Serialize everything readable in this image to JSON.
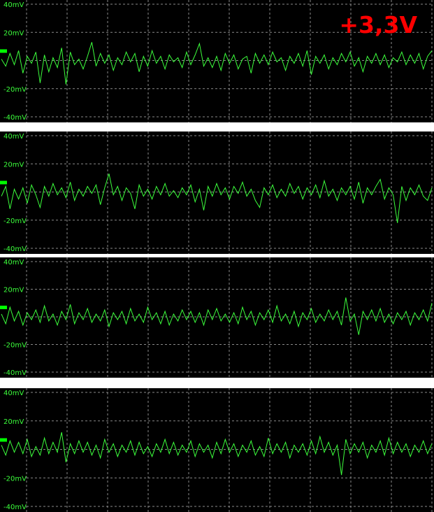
{
  "badge": {
    "label": "+3,3V",
    "color": "#ff0000"
  },
  "colors": {
    "background": "#000000",
    "grid": "#8a8a8a",
    "trace": "#3cff3c",
    "tick_text": "#3cff3c",
    "marker": "#00ff00"
  },
  "chart_data": [
    {
      "type": "line",
      "ytick_labels": [
        "40mV",
        "20mV",
        "",
        "-20mV",
        "-40mV"
      ],
      "ylim": [
        -40,
        40
      ],
      "grid": true,
      "x": [
        0,
        0.01,
        0.02,
        0.03,
        0.04,
        0.05,
        0.06,
        0.07,
        0.08,
        0.09,
        0.1,
        0.11,
        0.12,
        0.13,
        0.14,
        0.15,
        0.16,
        0.17,
        0.18,
        0.19,
        0.2,
        0.21,
        0.22,
        0.23,
        0.24,
        0.25,
        0.26,
        0.27,
        0.28,
        0.29,
        0.3,
        0.31,
        0.32,
        0.33,
        0.34,
        0.35,
        0.36,
        0.37,
        0.38,
        0.39,
        0.4,
        0.41,
        0.42,
        0.43,
        0.44,
        0.45,
        0.46,
        0.47,
        0.48,
        0.49,
        0.5,
        0.51,
        0.52,
        0.53,
        0.54,
        0.55,
        0.56,
        0.57,
        0.58,
        0.59,
        0.6,
        0.61,
        0.62,
        0.63,
        0.64,
        0.65,
        0.66,
        0.67,
        0.68,
        0.69,
        0.7,
        0.71,
        0.72,
        0.73,
        0.74,
        0.75,
        0.76,
        0.77,
        0.78,
        0.79,
        0.8,
        0.81,
        0.82,
        0.83,
        0.84,
        0.85,
        0.86,
        0.87,
        0.88,
        0.89,
        0.9,
        0.91,
        0.92,
        0.93,
        0.94,
        0.95,
        0.96,
        0.97,
        0.98,
        0.99,
        1
      ],
      "values": [
        1,
        -4,
        5,
        -3,
        7,
        -9,
        3,
        -2,
        6,
        -16,
        4,
        -8,
        2,
        -5,
        9,
        -17,
        6,
        -3,
        1,
        -6,
        3,
        13,
        -4,
        5,
        -2,
        4,
        -7,
        2,
        -3,
        6,
        -1,
        5,
        -8,
        3,
        -4,
        7,
        -2,
        3,
        -6,
        4,
        -1,
        2,
        -5,
        6,
        -3,
        4,
        12,
        -4,
        2,
        -5,
        3,
        -7,
        5,
        -2,
        4,
        -6,
        1,
        3,
        -9,
        5,
        -2,
        4,
        -3,
        6,
        -1,
        2,
        -7,
        3,
        -2,
        5,
        -4,
        7,
        -10,
        3,
        -2,
        4,
        -6,
        2,
        -3,
        5,
        -1,
        6,
        -4,
        2,
        -8,
        3,
        -2,
        5,
        -3,
        4,
        -5,
        2,
        -1,
        6,
        -3,
        4,
        -2,
        5,
        -6,
        3,
        7,
        -4,
        1
      ]
    },
    {
      "type": "line",
      "ytick_labels": [
        "40mV",
        "20mV",
        "",
        "-20mV",
        "-40mV"
      ],
      "ylim": [
        -40,
        40
      ],
      "grid": true,
      "x": [
        0,
        0.01,
        0.02,
        0.03,
        0.04,
        0.05,
        0.06,
        0.07,
        0.08,
        0.09,
        0.1,
        0.11,
        0.12,
        0.13,
        0.14,
        0.15,
        0.16,
        0.17,
        0.18,
        0.19,
        0.2,
        0.21,
        0.22,
        0.23,
        0.24,
        0.25,
        0.26,
        0.27,
        0.28,
        0.29,
        0.3,
        0.31,
        0.32,
        0.33,
        0.34,
        0.35,
        0.36,
        0.37,
        0.38,
        0.39,
        0.4,
        0.41,
        0.42,
        0.43,
        0.44,
        0.45,
        0.46,
        0.47,
        0.48,
        0.49,
        0.5,
        0.51,
        0.52,
        0.53,
        0.54,
        0.55,
        0.56,
        0.57,
        0.58,
        0.59,
        0.6,
        0.61,
        0.62,
        0.63,
        0.64,
        0.65,
        0.66,
        0.67,
        0.68,
        0.69,
        0.7,
        0.71,
        0.72,
        0.73,
        0.74,
        0.75,
        0.76,
        0.77,
        0.78,
        0.79,
        0.8,
        0.81,
        0.82,
        0.83,
        0.84,
        0.85,
        0.86,
        0.87,
        0.88,
        0.89,
        0.9,
        0.91,
        0.92,
        0.93,
        0.94,
        0.95,
        0.96,
        0.97,
        0.98,
        0.99,
        1
      ],
      "values": [
        -3,
        4,
        -12,
        2,
        -5,
        3,
        -8,
        5,
        -2,
        -11,
        4,
        -3,
        6,
        -2,
        3,
        -4,
        7,
        -6,
        2,
        -3,
        4,
        -1,
        5,
        -9,
        3,
        13,
        -2,
        4,
        -6,
        3,
        -1,
        -12,
        5,
        -3,
        2,
        -5,
        4,
        -2,
        6,
        -3,
        1,
        -4,
        3,
        -2,
        5,
        -7,
        2,
        -13,
        4,
        -3,
        6,
        -2,
        3,
        -5,
        4,
        -1,
        7,
        -3,
        2,
        -6,
        -11,
        3,
        -2,
        5,
        -4,
        2,
        -3,
        6,
        -1,
        4,
        -5,
        3,
        -2,
        5,
        -4,
        8,
        -3,
        2,
        -6,
        3,
        -2,
        4,
        -5,
        7,
        -8,
        3,
        -2,
        4,
        9,
        -5,
        3,
        -2,
        -22,
        4,
        -6,
        3,
        -2,
        5,
        -3,
        -6,
        3
      ]
    },
    {
      "type": "line",
      "ytick_labels": [
        "40mV",
        "20mV",
        "",
        "-20mV",
        "-40mV"
      ],
      "ylim": [
        -40,
        40
      ],
      "grid": true,
      "x": [
        0,
        0.01,
        0.02,
        0.03,
        0.04,
        0.05,
        0.06,
        0.07,
        0.08,
        0.09,
        0.1,
        0.11,
        0.12,
        0.13,
        0.14,
        0.15,
        0.16,
        0.17,
        0.18,
        0.19,
        0.2,
        0.21,
        0.22,
        0.23,
        0.24,
        0.25,
        0.26,
        0.27,
        0.28,
        0.29,
        0.3,
        0.31,
        0.32,
        0.33,
        0.34,
        0.35,
        0.36,
        0.37,
        0.38,
        0.39,
        0.4,
        0.41,
        0.42,
        0.43,
        0.44,
        0.45,
        0.46,
        0.47,
        0.48,
        0.49,
        0.5,
        0.51,
        0.52,
        0.53,
        0.54,
        0.55,
        0.56,
        0.57,
        0.58,
        0.59,
        0.6,
        0.61,
        0.62,
        0.63,
        0.64,
        0.65,
        0.66,
        0.67,
        0.68,
        0.69,
        0.7,
        0.71,
        0.72,
        0.73,
        0.74,
        0.75,
        0.76,
        0.77,
        0.78,
        0.79,
        0.8,
        0.81,
        0.82,
        0.83,
        0.84,
        0.85,
        0.86,
        0.87,
        0.88,
        0.89,
        0.9,
        0.91,
        0.92,
        0.93,
        0.94,
        0.95,
        0.96,
        0.97,
        0.98,
        0.99,
        1
      ],
      "values": [
        2,
        -5,
        7,
        -3,
        4,
        -6,
        3,
        -2,
        5,
        -4,
        8,
        -3,
        2,
        -6,
        4,
        -2,
        9,
        -5,
        3,
        -2,
        6,
        -4,
        2,
        -3,
        5,
        -7,
        3,
        -2,
        4,
        -5,
        6,
        -3,
        2,
        -4,
        7,
        -2,
        3,
        -5,
        4,
        -6,
        2,
        -3,
        5,
        -2,
        4,
        -4,
        3,
        -6,
        5,
        -2,
        6,
        -3,
        2,
        -4,
        3,
        -5,
        7,
        -2,
        4,
        -6,
        3,
        -2,
        5,
        -4,
        8,
        -3,
        2,
        -5,
        4,
        -7,
        3,
        -2,
        6,
        -4,
        2,
        -3,
        5,
        -2,
        4,
        -6,
        14,
        -3,
        2,
        -13,
        4,
        -2,
        5,
        -3,
        6,
        -4,
        2,
        -5,
        3,
        -2,
        4,
        -6,
        3,
        -2,
        5,
        -3,
        10
      ]
    },
    {
      "type": "line",
      "ytick_labels": [
        "40mV",
        "20mV",
        "",
        "-20mV",
        "-40mV"
      ],
      "ylim": [
        -40,
        40
      ],
      "grid": true,
      "x": [
        0,
        0.01,
        0.02,
        0.03,
        0.04,
        0.05,
        0.06,
        0.07,
        0.08,
        0.09,
        0.1,
        0.11,
        0.12,
        0.13,
        0.14,
        0.15,
        0.16,
        0.17,
        0.18,
        0.19,
        0.2,
        0.21,
        0.22,
        0.23,
        0.24,
        0.25,
        0.26,
        0.27,
        0.28,
        0.29,
        0.3,
        0.31,
        0.32,
        0.33,
        0.34,
        0.35,
        0.36,
        0.37,
        0.38,
        0.39,
        0.4,
        0.41,
        0.42,
        0.43,
        0.44,
        0.45,
        0.46,
        0.47,
        0.48,
        0.49,
        0.5,
        0.51,
        0.52,
        0.53,
        0.54,
        0.55,
        0.56,
        0.57,
        0.58,
        0.59,
        0.6,
        0.61,
        0.62,
        0.63,
        0.64,
        0.65,
        0.66,
        0.67,
        0.68,
        0.69,
        0.7,
        0.71,
        0.72,
        0.73,
        0.74,
        0.75,
        0.76,
        0.77,
        0.78,
        0.79,
        0.8,
        0.81,
        0.82,
        0.83,
        0.84,
        0.85,
        0.86,
        0.87,
        0.88,
        0.89,
        0.9,
        0.91,
        0.92,
        0.93,
        0.94,
        0.95,
        0.96,
        0.97,
        0.98,
        0.99,
        1
      ],
      "values": [
        3,
        -4,
        6,
        -2,
        5,
        -3,
        7,
        -5,
        2,
        -4,
        8,
        -3,
        5,
        -2,
        12,
        -9,
        4,
        -3,
        6,
        -2,
        5,
        -4,
        3,
        -6,
        7,
        -2,
        4,
        -5,
        3,
        -2,
        6,
        -4,
        5,
        -3,
        2,
        -5,
        4,
        -2,
        7,
        -3,
        5,
        -4,
        3,
        -2,
        6,
        -5,
        4,
        -2,
        3,
        -6,
        5,
        -3,
        7,
        -2,
        4,
        -5,
        3,
        -2,
        6,
        -4,
        2,
        -5,
        8,
        -3,
        4,
        -2,
        5,
        -6,
        3,
        -2,
        4,
        -4,
        6,
        -3,
        9,
        -2,
        5,
        -4,
        3,
        -18,
        7,
        -3,
        4,
        -2,
        5,
        -6,
        3,
        -2,
        6,
        -4,
        8,
        -3,
        5,
        -2,
        4,
        -5,
        3,
        -2,
        6,
        -3,
        4
      ]
    }
  ]
}
